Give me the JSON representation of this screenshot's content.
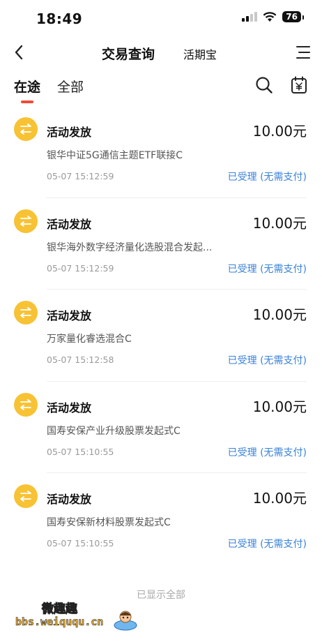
{
  "status_bar": {
    "time": "18:49",
    "battery": "76"
  },
  "nav": {
    "title": "交易查询",
    "subtitle": "活期宝"
  },
  "tabs": [
    {
      "label": "在途"
    },
    {
      "label": "全部"
    }
  ],
  "transactions": [
    {
      "title": "活动发放",
      "amount": "10.00元",
      "fund": "银华中证5G通信主题ETF联接C",
      "time": "05-07 15:12:59",
      "status": "已受理 (无需支付)"
    },
    {
      "title": "活动发放",
      "amount": "10.00元",
      "fund": "银华海外数字经济量化选股混合发起...",
      "time": "05-07 15:12:59",
      "status": "已受理 (无需支付)"
    },
    {
      "title": "活动发放",
      "amount": "10.00元",
      "fund": "万家量化睿选混合C",
      "time": "05-07 15:12:58",
      "status": "已受理 (无需支付)"
    },
    {
      "title": "活动发放",
      "amount": "10.00元",
      "fund": "国寿安保产业升级股票发起式C",
      "time": "05-07 15:10:55",
      "status": "已受理 (无需支付)"
    },
    {
      "title": "活动发放",
      "amount": "10.00元",
      "fund": "国寿安保新材料股票发起式C",
      "time": "05-07 15:10:55",
      "status": "已受理 (无需支付)"
    }
  ],
  "footer": {
    "text": "已显示全部"
  },
  "watermark": {
    "top": "微趣趣",
    "bottom": "bbs.weiququ.cn"
  },
  "colors": {
    "accent": "#ef4b39",
    "status_blue": "#3a82d8",
    "icon_yellow": "#f7c234"
  },
  "icons": {
    "back": "chevron-left-icon",
    "menu": "menu-icon",
    "search": "search-icon",
    "calendar": "calendar-icon",
    "transfer": "transfer-arrows-icon"
  }
}
